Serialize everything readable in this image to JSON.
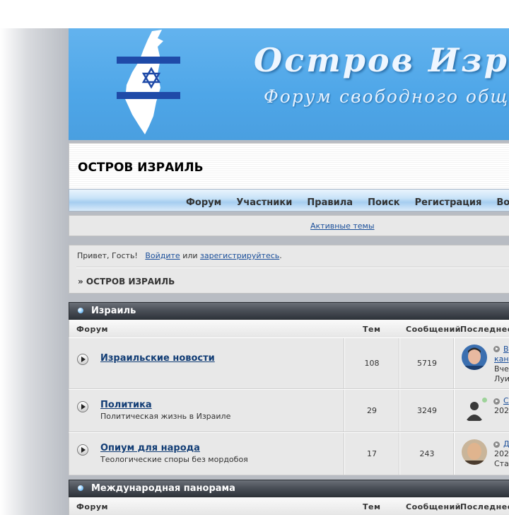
{
  "banner": {
    "title": "Остров Израиль",
    "subtitle": "Форум свободного общения"
  },
  "site_title": "ОСТРОВ ИЗРАИЛЬ",
  "nav": [
    "Форум",
    "Участники",
    "Правила",
    "Поиск",
    "Регистрация",
    "Войти"
  ],
  "active_topics": "Активные темы",
  "welcome": {
    "greeting": "Привет, Гость!",
    "login": "Войдите",
    "or": "или",
    "register": "зарегистрируйтесь",
    "end": "."
  },
  "breadcrumb": "» ОСТРОВ ИЗРАИЛЬ",
  "columns": {
    "forum": "Форум",
    "topics": "Тем",
    "posts": "Сообщений",
    "last": "Последнее"
  },
  "categories": [
    {
      "name": "Израиль",
      "forums": [
        {
          "name": "Израильские новости",
          "desc": "",
          "topics": "108",
          "posts": "5719",
          "last_title_1": "В",
          "last_title_2": "кан",
          "last_date": "Вчер",
          "last_author": "Луи"
        },
        {
          "name": "Политика",
          "desc": "Политическая жизнь в Израиле",
          "topics": "29",
          "posts": "3249",
          "last_title_1": "С",
          "last_date": "202"
        },
        {
          "name": "Опиум для народа",
          "desc": "Теологические споры без мордобоя",
          "topics": "17",
          "posts": "243",
          "last_title_1": "Д",
          "last_date": "202",
          "last_author": "Ста"
        }
      ]
    },
    {
      "name": "Международная панорама"
    }
  ],
  "colors": {
    "banner_blue": "#4ea6e8",
    "link": "#123d75",
    "category_bar": "#3a3f46"
  }
}
